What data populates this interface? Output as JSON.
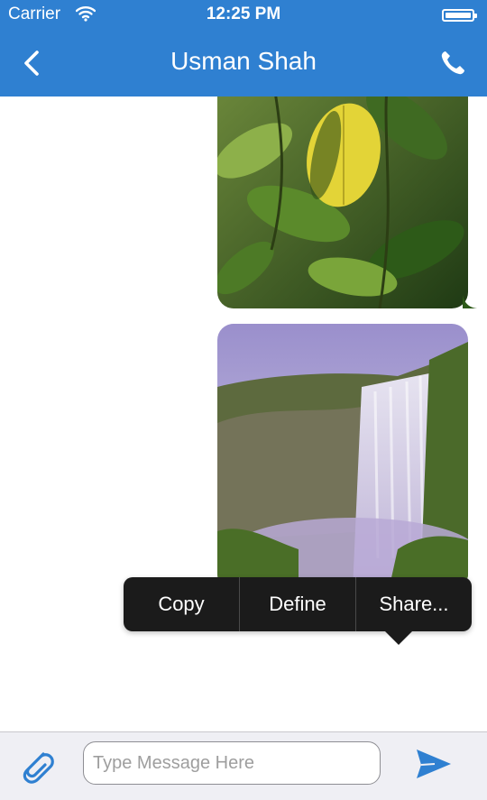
{
  "status": {
    "carrier": "Carrier",
    "time": "12:25 PM",
    "battery_level": 1.0
  },
  "nav": {
    "title": "Usman Shah",
    "back_icon": "chevron-left-icon",
    "call_icon": "phone-icon"
  },
  "messages": [
    {
      "kind": "image",
      "subject": "green leaves"
    },
    {
      "kind": "image",
      "subject": "waterfall"
    }
  ],
  "context_menu": {
    "items": [
      "Copy",
      "Define",
      "Share..."
    ]
  },
  "composer": {
    "placeholder": "Type Message Here",
    "value": "",
    "attach_icon": "paperclip-icon",
    "send_icon": "send-icon"
  },
  "colors": {
    "nav_bg": "#2f80d1",
    "accent": "#2f80d1",
    "menu_bg": "#1b1b1b",
    "input_bar_bg": "#efeff4"
  }
}
